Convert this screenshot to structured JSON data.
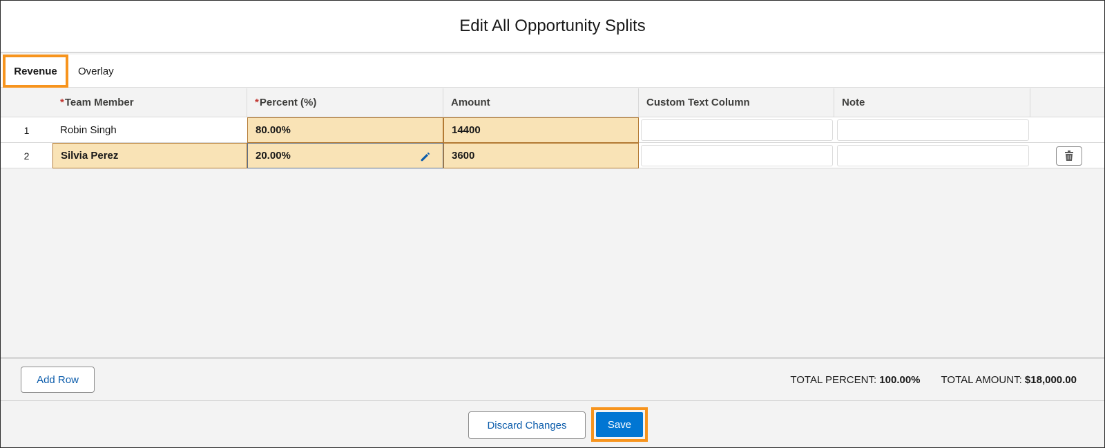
{
  "modal": {
    "title": "Edit All Opportunity Splits"
  },
  "tabs": [
    {
      "label": "Revenue",
      "active": true
    },
    {
      "label": "Overlay",
      "active": false
    }
  ],
  "table": {
    "required_marker": "*",
    "columns": [
      {
        "label": "Team Member",
        "required": true
      },
      {
        "label": "Percent (%)",
        "required": true
      },
      {
        "label": "Amount",
        "required": false
      },
      {
        "label": "Custom Text Column",
        "required": false
      },
      {
        "label": "Note",
        "required": false
      }
    ],
    "rows": [
      {
        "num": "1",
        "team_member": "Robin Singh",
        "percent": "80.00%",
        "amount": "14400",
        "custom_text": "",
        "note": ""
      },
      {
        "num": "2",
        "team_member": "Silvia Perez",
        "percent": "20.00%",
        "amount": "3600",
        "custom_text": "",
        "note": ""
      }
    ]
  },
  "footer": {
    "add_row_label": "Add Row",
    "total_percent_label": "TOTAL PERCENT:",
    "total_percent_value": "100.00%",
    "total_amount_label": "TOTAL AMOUNT:",
    "total_amount_value": "$18,000.00"
  },
  "actions": {
    "discard_label": "Discard Changes",
    "save_label": "Save"
  },
  "colors": {
    "highlight": "#f7941d",
    "edited_cell": "#f9e3b6",
    "brand": "#0176d3",
    "link": "#0b5cab",
    "required": "#c23934"
  },
  "icons": {
    "edit": "pencil-icon",
    "delete": "trash-icon"
  }
}
